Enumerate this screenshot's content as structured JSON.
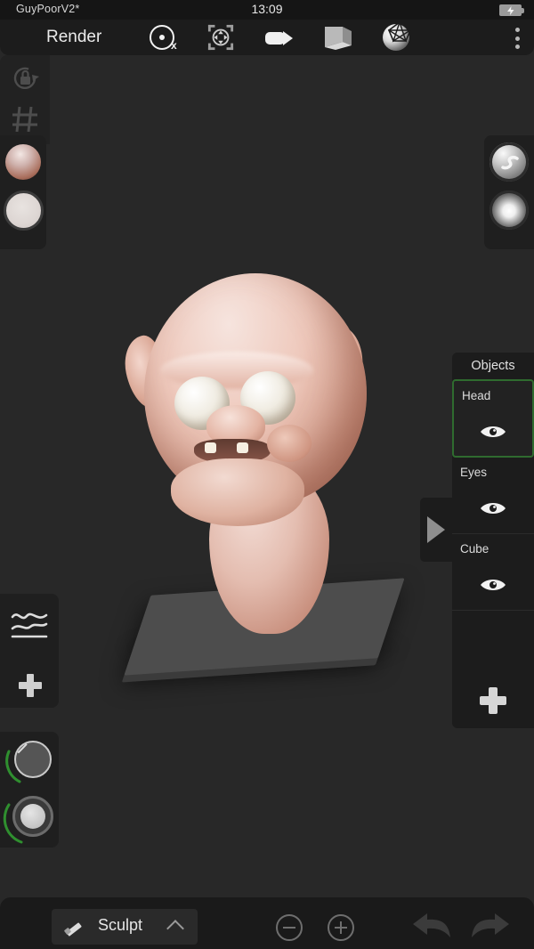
{
  "statusbar": {
    "title": "GuyPoorV2*",
    "clock": "13:09",
    "battery_icon": "battery-charging-icon"
  },
  "header": {
    "mode_label": "Render",
    "icons": [
      {
        "name": "pivot-icon",
        "marker": "x"
      },
      {
        "name": "transform-gizmo-icon"
      },
      {
        "name": "camera-icon"
      },
      {
        "name": "box-environment-icon"
      },
      {
        "name": "matcap-wireframe-sphere-icon"
      }
    ],
    "overflow_icon": "kebab-menu-icon"
  },
  "left_material_panel": {
    "swatches": [
      {
        "name": "material-ball-skin"
      },
      {
        "name": "material-ball-white"
      }
    ]
  },
  "right_material_panel": {
    "swatches": [
      {
        "name": "matcap-swirl"
      },
      {
        "name": "matcap-glossy-white"
      }
    ]
  },
  "left_curve_panel": {
    "curve_icon": "curve-profile-icon",
    "add_icon": "plus-icon"
  },
  "left_knob_panel": {
    "knobs": [
      {
        "name": "brush-radius-knob",
        "arc_color": "#2f8f2f"
      },
      {
        "name": "brush-intensity-knob",
        "arc_color": "#2f8f2f"
      }
    ]
  },
  "right_tool_panel": {
    "tools": [
      {
        "name": "lock-rotation-icon"
      },
      {
        "name": "grid-toggle-icon"
      }
    ]
  },
  "objects_panel": {
    "title": "Objects",
    "toggle_icon": "panel-expand-arrow-icon",
    "add_label": "add-object-icon",
    "items": [
      {
        "label": "Head",
        "selected": true,
        "visibility_icon": "eye-icon"
      },
      {
        "label": "Eyes",
        "selected": false,
        "visibility_icon": "eye-icon"
      },
      {
        "label": "Cube",
        "selected": false,
        "visibility_icon": "eye-icon"
      }
    ]
  },
  "bottombar": {
    "tool_label": "Sculpt",
    "tool_icon": "brush-icon",
    "expand_icon": "chevron-up-icon",
    "zoom_out_label": "zoom-out-icon",
    "zoom_in_label": "zoom-in-icon",
    "undo_label": "undo-icon",
    "redo_label": "redo-icon"
  },
  "colors": {
    "viewport_bg": "#282828",
    "panel_bg": "#1f1f1f",
    "bar_bg": "#1a1a1a",
    "status_bg": "#151515",
    "selection_green": "#2f6b2f",
    "arc_green": "#2f8f2f",
    "text": "#e2e2e2"
  }
}
